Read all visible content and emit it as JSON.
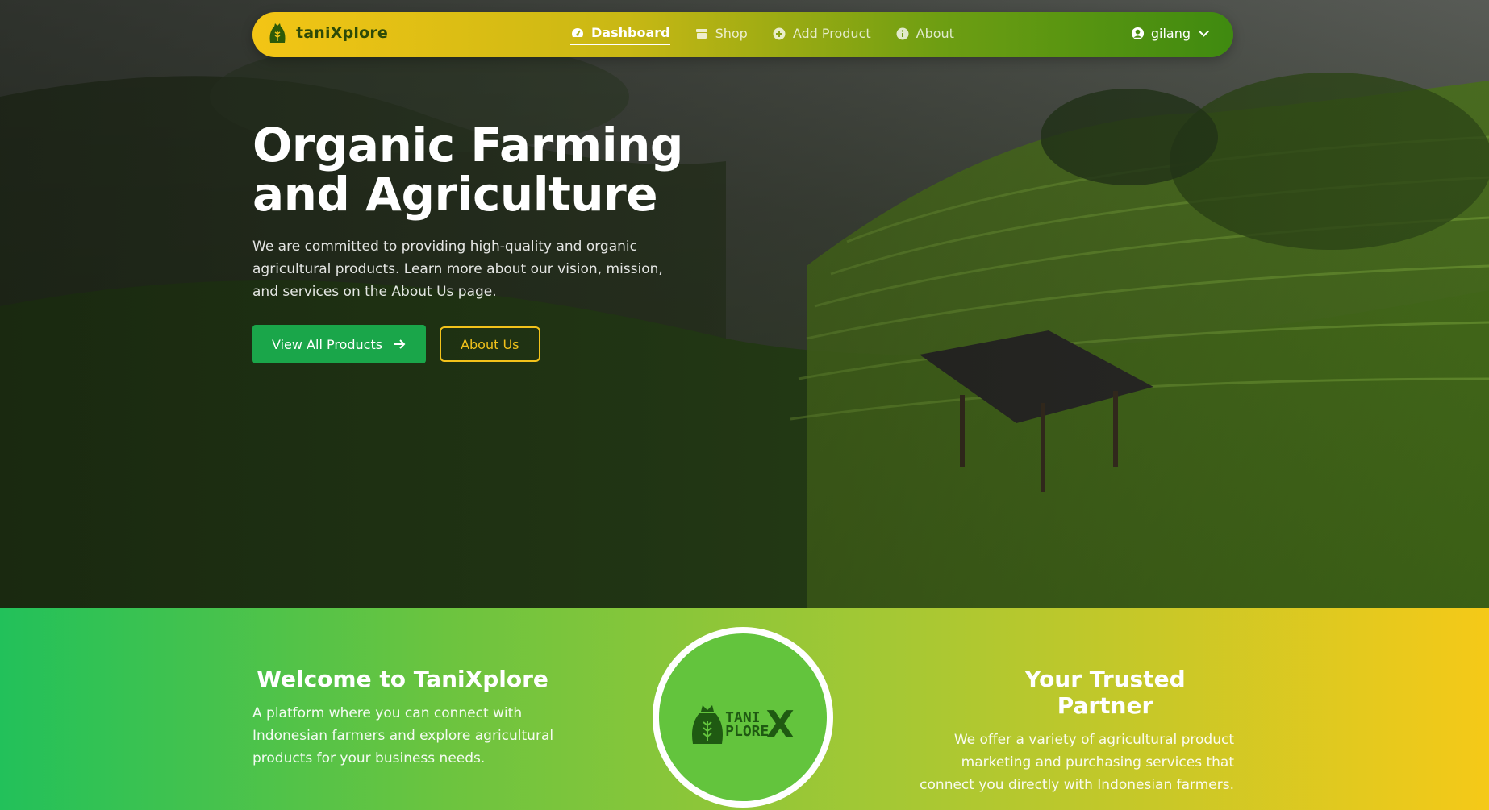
{
  "navbar": {
    "brand": "taniXplore",
    "links": [
      {
        "label": "Dashboard",
        "icon": "gauge-icon",
        "active": true
      },
      {
        "label": "Shop",
        "icon": "store-icon",
        "active": false
      },
      {
        "label": "Add Product",
        "icon": "plus-circle-icon",
        "active": false
      },
      {
        "label": "About",
        "icon": "info-circle-icon",
        "active": false
      }
    ],
    "user": "gilang"
  },
  "hero": {
    "title_line1": "Organic Farming",
    "title_line2": "and Agriculture",
    "description": "We are committed to providing high-quality and organic agricultural products. Learn more about our vision, mission, and services on the About Us page.",
    "primary_button": "View All Products",
    "secondary_button": "About Us"
  },
  "band": {
    "welcome_title": "Welcome to TaniXplore",
    "welcome_text": "A platform where you can connect with Indonesian farmers and explore agricultural products for your business needs.",
    "partner_title": "Your Trusted Partner",
    "partner_text": "We offer a variety of agricultural product marketing and purchasing services that connect you directly with Indonesian farmers.",
    "logo_line1": "TANI",
    "logo_line2": "PLORE",
    "logo_x": "X"
  },
  "colors": {
    "accent_green": "#1aa64a",
    "accent_yellow": "#f2c21b",
    "nav_text_dark": "#2d4a07"
  }
}
